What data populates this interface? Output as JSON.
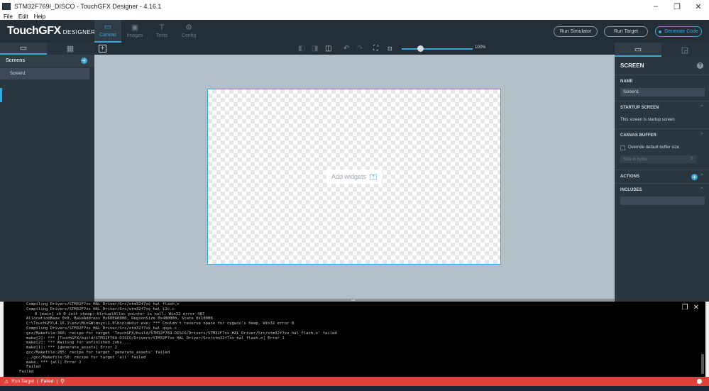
{
  "window": {
    "title": "STM32F769I_DISCO - TouchGFX Designer - 4.16.1",
    "controls": [
      "–",
      "❐",
      "✕"
    ]
  },
  "menu": [
    "File",
    "Edit",
    "Help"
  ],
  "header": {
    "logo": "TouchGFX",
    "logo_sub": "DESIGNER",
    "tabs": [
      {
        "label": "Canvas",
        "icon": "canvas-icon"
      },
      {
        "label": "Images",
        "icon": "images-icon"
      },
      {
        "label": "Texts",
        "icon": "texts-icon"
      },
      {
        "label": "Config",
        "icon": "config-icon"
      }
    ],
    "run_simulator": "Run Simulator",
    "run_target": "Run Target",
    "generate_code": "Generate Code"
  },
  "left_panel": {
    "section_title": "Screens",
    "screens": [
      "Screen1"
    ]
  },
  "toolbar": {
    "zoom": "100%"
  },
  "canvas": {
    "add_widgets": "Add widgets"
  },
  "right_panel": {
    "title": "SCREEN",
    "name_label": "NAME",
    "name_value": "Screen1",
    "startup_label": "STARTUP SCREEN",
    "startup_text": "This screen is startup screen",
    "buffer_label": "CANVAS BUFFER",
    "buffer_checkbox": "Override default buffer size",
    "buffer_placeholder": "Size in bytes",
    "actions_label": "ACTIONS",
    "includes_label": "INCLUDES"
  },
  "console": {
    "lines": [
      "Compiling Drivers/STM32F7xx_HAL_Driver/Src/stm32f7xx_hal_flash.c",
      "Compiling Drivers/STM32F7xx_HAL_Driver/Src/stm32f7xx_hal_i2c.c",
      "0 [main] sh 0 init_cheap: VirtualAlloc pointer is null, Win32 error 487",
      "AllocationBase 0x0, BaseAddress 0x60EA0000, RegionSize 0x480000, State 0x10000",
      "C:\\TouchGFX\\4.16.1\\env\\MinGW\\msys\\1.0\\bin\\mkdir.exe: *** Couldn't reserve space for cygwin's heap, Win32 error 0",
      "Compiling Drivers/STM32F7xx_HAL_Driver/Src/stm32f7xx_hal_qspi.c",
      "gcc/Makefile:366: recipe for target 'TouchGFX/build/STM32F769-DISCO/Drivers/STM32F7xx_HAL_Driver/Src/stm32f7xx_hal_flash.o' failed",
      "make[2]: *** [TouchGFX/build/STM32F769-DISCO/Drivers/STM32F7xx_HAL_Driver/Src/stm32f7xx_hal_flash.o] Error 1",
      "make[2]: *** Waiting for unfinished jobs....",
      "make[1]: *** [generate_assets] Error 2",
      "gcc/Makefile:285: recipe for target 'generate_assets' failed",
      "../gcc/Makefile:50: recipe for target 'all' failed",
      "make: *** [all] Error 2",
      "Failed",
      "Failed"
    ]
  },
  "status": {
    "action": "Run Target",
    "result": "Failed"
  }
}
